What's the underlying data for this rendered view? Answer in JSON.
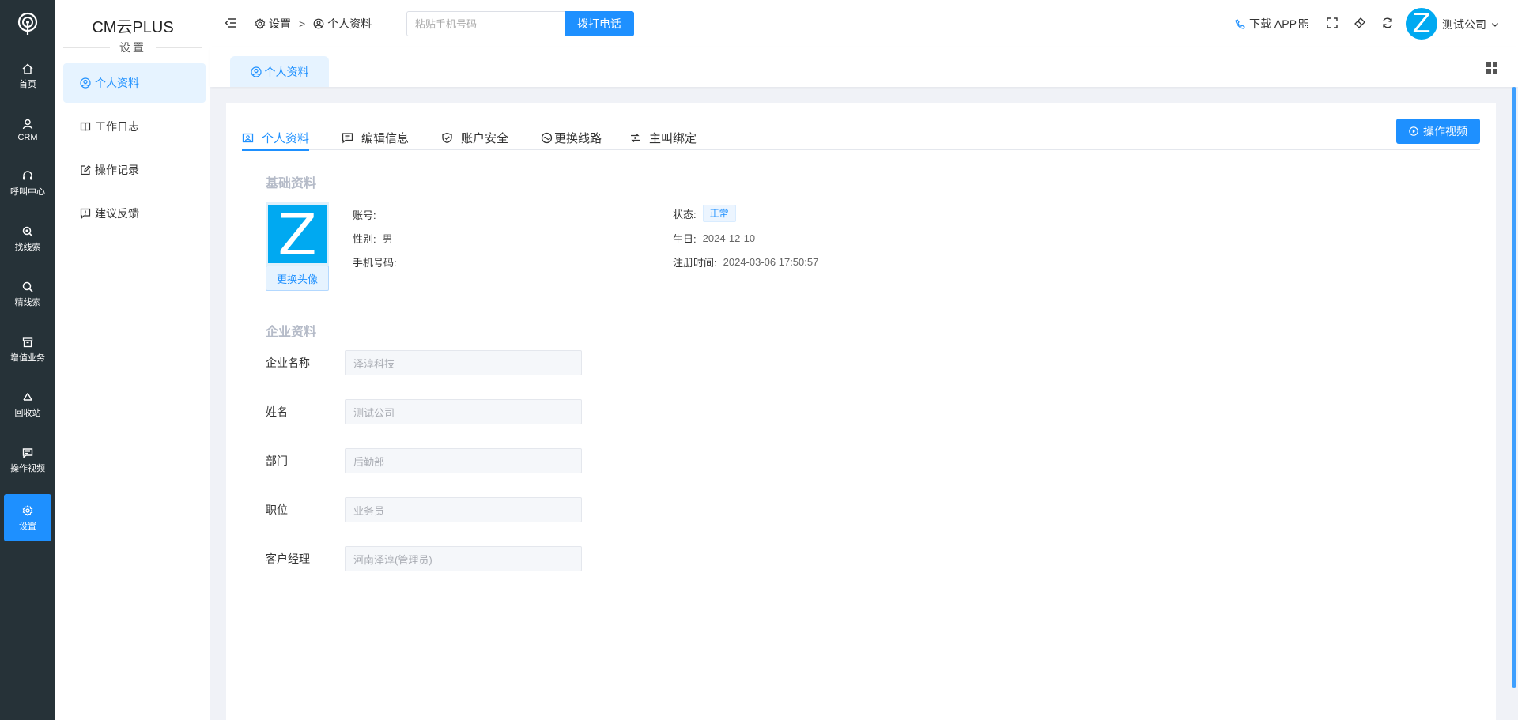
{
  "app": {
    "title": "CM云PLUS",
    "subtitle": "设置"
  },
  "rail": {
    "items": [
      {
        "label": "首页",
        "icon": "home-icon"
      },
      {
        "label": "CRM",
        "icon": "user-icon"
      },
      {
        "label": "呼叫中心",
        "icon": "headset-icon"
      },
      {
        "label": "找线索",
        "icon": "search-plus-icon"
      },
      {
        "label": "精线索",
        "icon": "search-icon"
      },
      {
        "label": "增值业务",
        "icon": "box-icon"
      },
      {
        "label": "回收站",
        "icon": "recycle-icon"
      },
      {
        "label": "操作视频",
        "icon": "message-icon"
      },
      {
        "label": "设置",
        "icon": "gear-icon"
      }
    ],
    "active": "设置"
  },
  "sidebar": {
    "items": [
      {
        "label": "个人资料",
        "icon": "user-circle-icon"
      },
      {
        "label": "工作日志",
        "icon": "book-icon"
      },
      {
        "label": "操作记录",
        "icon": "edit-icon"
      },
      {
        "label": "建议反馈",
        "icon": "feedback-icon"
      }
    ],
    "active": "个人资料"
  },
  "header": {
    "breadcrumb": [
      "设置",
      "个人资料"
    ],
    "breadcrumb_sep": ">",
    "phone_placeholder": "粘贴手机号码",
    "call_label": "拨打电话",
    "download_label": "下载 APP",
    "user_name": "测试公司",
    "avatar_letter": "Z"
  },
  "tabbar": {
    "tag_label": "个人资料"
  },
  "main": {
    "tabs": [
      {
        "label": "个人资料",
        "icon": "id-card-icon"
      },
      {
        "label": "编辑信息",
        "icon": "message-edit-icon"
      },
      {
        "label": "账户安全",
        "icon": "shield-icon"
      },
      {
        "label": "更换线路",
        "icon": "route-icon"
      },
      {
        "label": "主叫绑定",
        "icon": "link-icon"
      }
    ],
    "active_tab": "个人资料",
    "video_button": "操作视频",
    "basic_title": "基础资料",
    "avatar_letter": "Z",
    "change_avatar": "更换头像",
    "basic": {
      "account_label": "账号:",
      "account_value": "",
      "gender_label": "性别:",
      "gender_value": "男",
      "phone_label": "手机号码:",
      "phone_value": "",
      "status_label": "状态:",
      "status_value": "正常",
      "birthday_label": "生日:",
      "birthday_value": "2024-12-10",
      "register_label": "注册时间:",
      "register_value": "2024-03-06 17:50:57"
    },
    "company_title": "企业资料",
    "company_fields": [
      {
        "label": "企业名称",
        "value": "泽淳科技"
      },
      {
        "label": "姓名",
        "value": "测试公司"
      },
      {
        "label": "部门",
        "value": "后勤部"
      },
      {
        "label": "职位",
        "value": "业务员"
      },
      {
        "label": "客户经理",
        "value": "河南泽淳(管理员)"
      }
    ]
  },
  "colors": {
    "rail_bg": "#263238",
    "accent": "#1e90ff",
    "avatar": "#00a9f1",
    "page_bg": "#f0f2f7"
  }
}
